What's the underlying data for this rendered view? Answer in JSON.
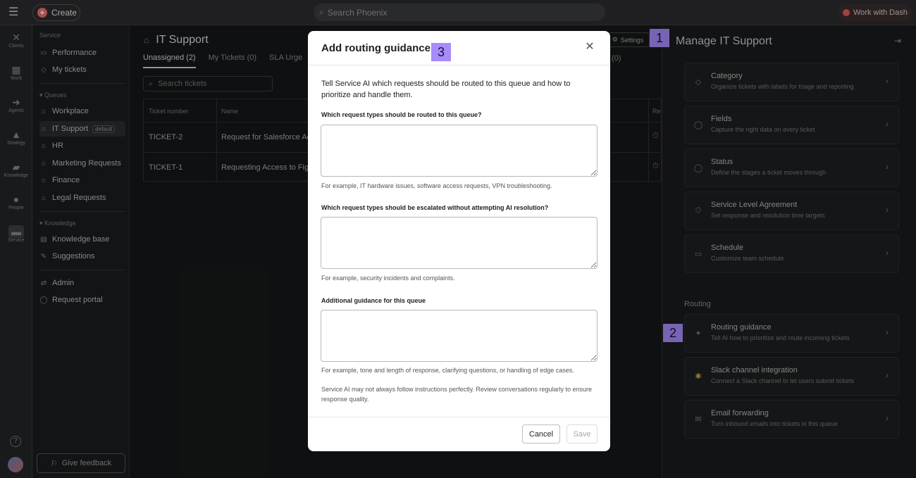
{
  "topbar": {
    "create_label": "Create",
    "search_placeholder": "Search Phoenix",
    "work_with_dash_label": "Work with Dash"
  },
  "rail": [
    {
      "label": "Clients",
      "icon": "clients-icon"
    },
    {
      "label": "Work",
      "icon": "work-icon"
    },
    {
      "label": "Agents",
      "icon": "agents-icon"
    },
    {
      "label": "Strategy",
      "icon": "strategy-icon"
    },
    {
      "label": "Knowledge",
      "icon": "knowledge-icon"
    },
    {
      "label": "People",
      "icon": "people-icon"
    },
    {
      "label": "Service",
      "icon": "service-icon"
    }
  ],
  "sidebar": {
    "section_service": "Service",
    "performance": "Performance",
    "my_tickets": "My tickets",
    "section_queues": "Queues",
    "queues": [
      "Workplace",
      "IT Support",
      "HR",
      "Marketing Requests",
      "Finance",
      "Legal Requests"
    ],
    "default_badge": "default",
    "section_knowledge": "Knowledge",
    "knowledge_base": "Knowledge base",
    "suggestions": "Suggestions",
    "admin": "Admin",
    "request_portal": "Request portal",
    "give_feedback": "Give feedback"
  },
  "main": {
    "title": "IT Support",
    "tabs": [
      "Unassigned (2)",
      "My Tickets (0)",
      "SLA Urge"
    ],
    "tab_right": "(0)",
    "settings_label": "Settings",
    "search_placeholder": "Search tickets",
    "columns": [
      "Ticket number",
      "Name",
      "Re"
    ],
    "rows": [
      {
        "id": "TICKET-2",
        "name": "Request for Salesforce Ac"
      },
      {
        "id": "TICKET-1",
        "name": "Requesting Access to Fig"
      }
    ]
  },
  "right_panel": {
    "title": "Manage IT Support",
    "cards": [
      {
        "title": "Category",
        "desc": "Organize tickets with labels for triage and reporting",
        "icon": "tag-icon"
      },
      {
        "title": "Fields",
        "desc": "Capture the right data on every ticket",
        "icon": "fields-icon"
      },
      {
        "title": "Status",
        "desc": "Define the stages a ticket moves through",
        "icon": "status-icon"
      },
      {
        "title": "Service Level Agreement",
        "desc": "Set response and resolution time targets",
        "icon": "timer-icon"
      },
      {
        "title": "Schedule",
        "desc": "Customize team schedule",
        "icon": "calendar-icon"
      }
    ],
    "routing_label": "Routing",
    "routing_cards": [
      {
        "title": "Routing guidance",
        "desc": "Tell AI how to prioritize and route incoming tickets",
        "icon": "sparkle-icon"
      },
      {
        "title": "Slack channel integration",
        "desc": "Connect a Slack channel to let users submit tickets",
        "icon": "slack-icon"
      },
      {
        "title": "Email forwarding",
        "desc": "Turn inbound emails into tickets in this queue",
        "icon": "mail-icon"
      }
    ]
  },
  "callouts": [
    "1",
    "2",
    "3"
  ],
  "modal": {
    "title": "Add routing guidance",
    "intro": "Tell Service AI which requests should be routed to this queue and how to prioritize and handle them.",
    "q1_label": "Which request types should be routed to this queue?",
    "q1_value": "",
    "q1_hint": "For example, IT hardware issues, software access requests, VPN troubleshooting.",
    "q2_label": "Which request types should be escalated without attempting AI resolution?",
    "q2_value": "",
    "q2_hint": "For example, security incidents and complaints.",
    "q3_label": "Additional guidance for this queue",
    "q3_value": "",
    "q3_hint": "For example, tone and length of response, clarifying questions, or handling of edge cases.",
    "note": "Service AI may not always follow instructions perfectly. Review conversations regularly to ensure response quality.",
    "cancel_label": "Cancel",
    "save_label": "Save"
  },
  "colors": {
    "callout": "#a78bfa",
    "create_accent": "#f06a6a",
    "sla_timer": "#c25a5a"
  }
}
